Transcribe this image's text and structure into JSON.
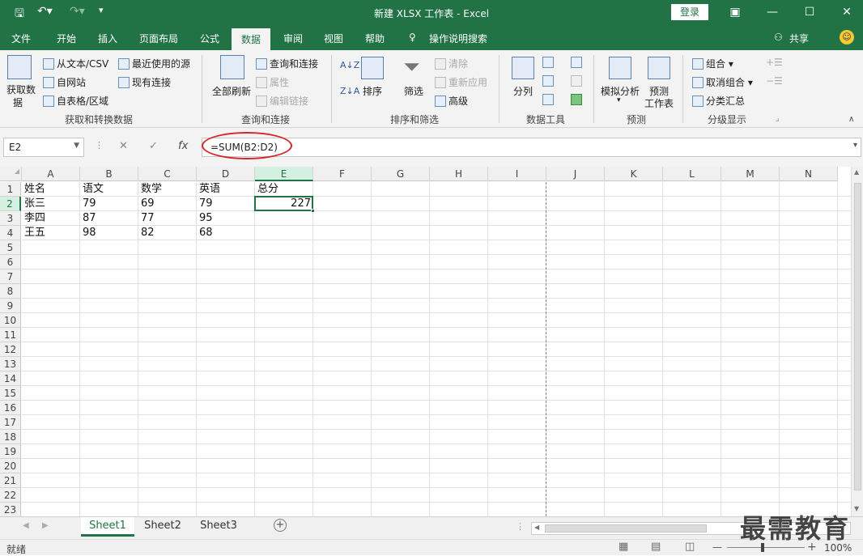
{
  "window": {
    "title": "新建 XLSX 工作表  -  Excel",
    "login_label": "登录",
    "colors": {
      "accent": "#217346",
      "selection_ring": "#d6262a"
    }
  },
  "quick_access": {
    "save": "save-icon",
    "undo": "undo-icon",
    "redo": "redo-icon",
    "customize": "customize-icon"
  },
  "tabs": [
    "文件",
    "开始",
    "插入",
    "页面布局",
    "公式",
    "数据",
    "审阅",
    "视图",
    "帮助"
  ],
  "active_tab": "数据",
  "tell_me": "操作说明搜索",
  "share_label": "共享",
  "ribbon": {
    "get_data": {
      "label_top": "获取数",
      "label_bottom": "据",
      "from_csv": "从文本/CSV",
      "from_web": "自网站",
      "from_table": "自表格/区域",
      "recent_sources": "最近使用的源",
      "existing_conn": "现有连接",
      "group_label": "获取和转换数据"
    },
    "queries": {
      "refresh_all": "全部刷新",
      "queries_conn": "查询和连接",
      "properties": "属性",
      "edit_links": "编辑链接",
      "group_label": "查询和连接"
    },
    "sort_filter": {
      "sort": "排序",
      "filter": "筛选",
      "clear": "清除",
      "reapply": "重新应用",
      "advanced": "高级",
      "group_label": "排序和筛选"
    },
    "data_tools": {
      "text_to_columns": "分列",
      "group_label": "数据工具"
    },
    "forecast": {
      "what_if": "模拟分析",
      "forecast_sheet_top": "预测",
      "forecast_sheet_bottom": "工作表",
      "group_label": "预测"
    },
    "outline": {
      "group": "组合",
      "ungroup": "取消组合",
      "subtotal": "分类汇总",
      "group_label": "分级显示"
    }
  },
  "formula_bar": {
    "name_box": "E2",
    "cancel": "✕",
    "enter": "✓",
    "fx": "fx",
    "formula": "=SUM(B2:D2)"
  },
  "grid": {
    "columns": [
      "A",
      "B",
      "C",
      "D",
      "E",
      "F",
      "G",
      "H",
      "I",
      "J",
      "K",
      "L",
      "M",
      "N"
    ],
    "rows": [
      "1",
      "2",
      "3",
      "4",
      "5",
      "6",
      "7",
      "8",
      "9",
      "10",
      "11",
      "12",
      "13",
      "14",
      "15",
      "16",
      "17",
      "18",
      "19",
      "20",
      "21",
      "22",
      "23"
    ],
    "selected_col": "E",
    "selected_row": "2",
    "data": [
      [
        "姓名",
        "语文",
        "数学",
        "英语",
        "总分"
      ],
      [
        "张三",
        "79",
        "69",
        "79",
        "227"
      ],
      [
        "李四",
        "87",
        "77",
        "95",
        ""
      ],
      [
        "王五",
        "98",
        "82",
        "68",
        ""
      ]
    ]
  },
  "sheets": [
    "Sheet1",
    "Sheet2",
    "Sheet3"
  ],
  "active_sheet": "Sheet1",
  "status": {
    "ready": "就绪",
    "zoom": "100%",
    "zoom_minus": "—",
    "zoom_plus": "+"
  },
  "watermark": "最需教育"
}
